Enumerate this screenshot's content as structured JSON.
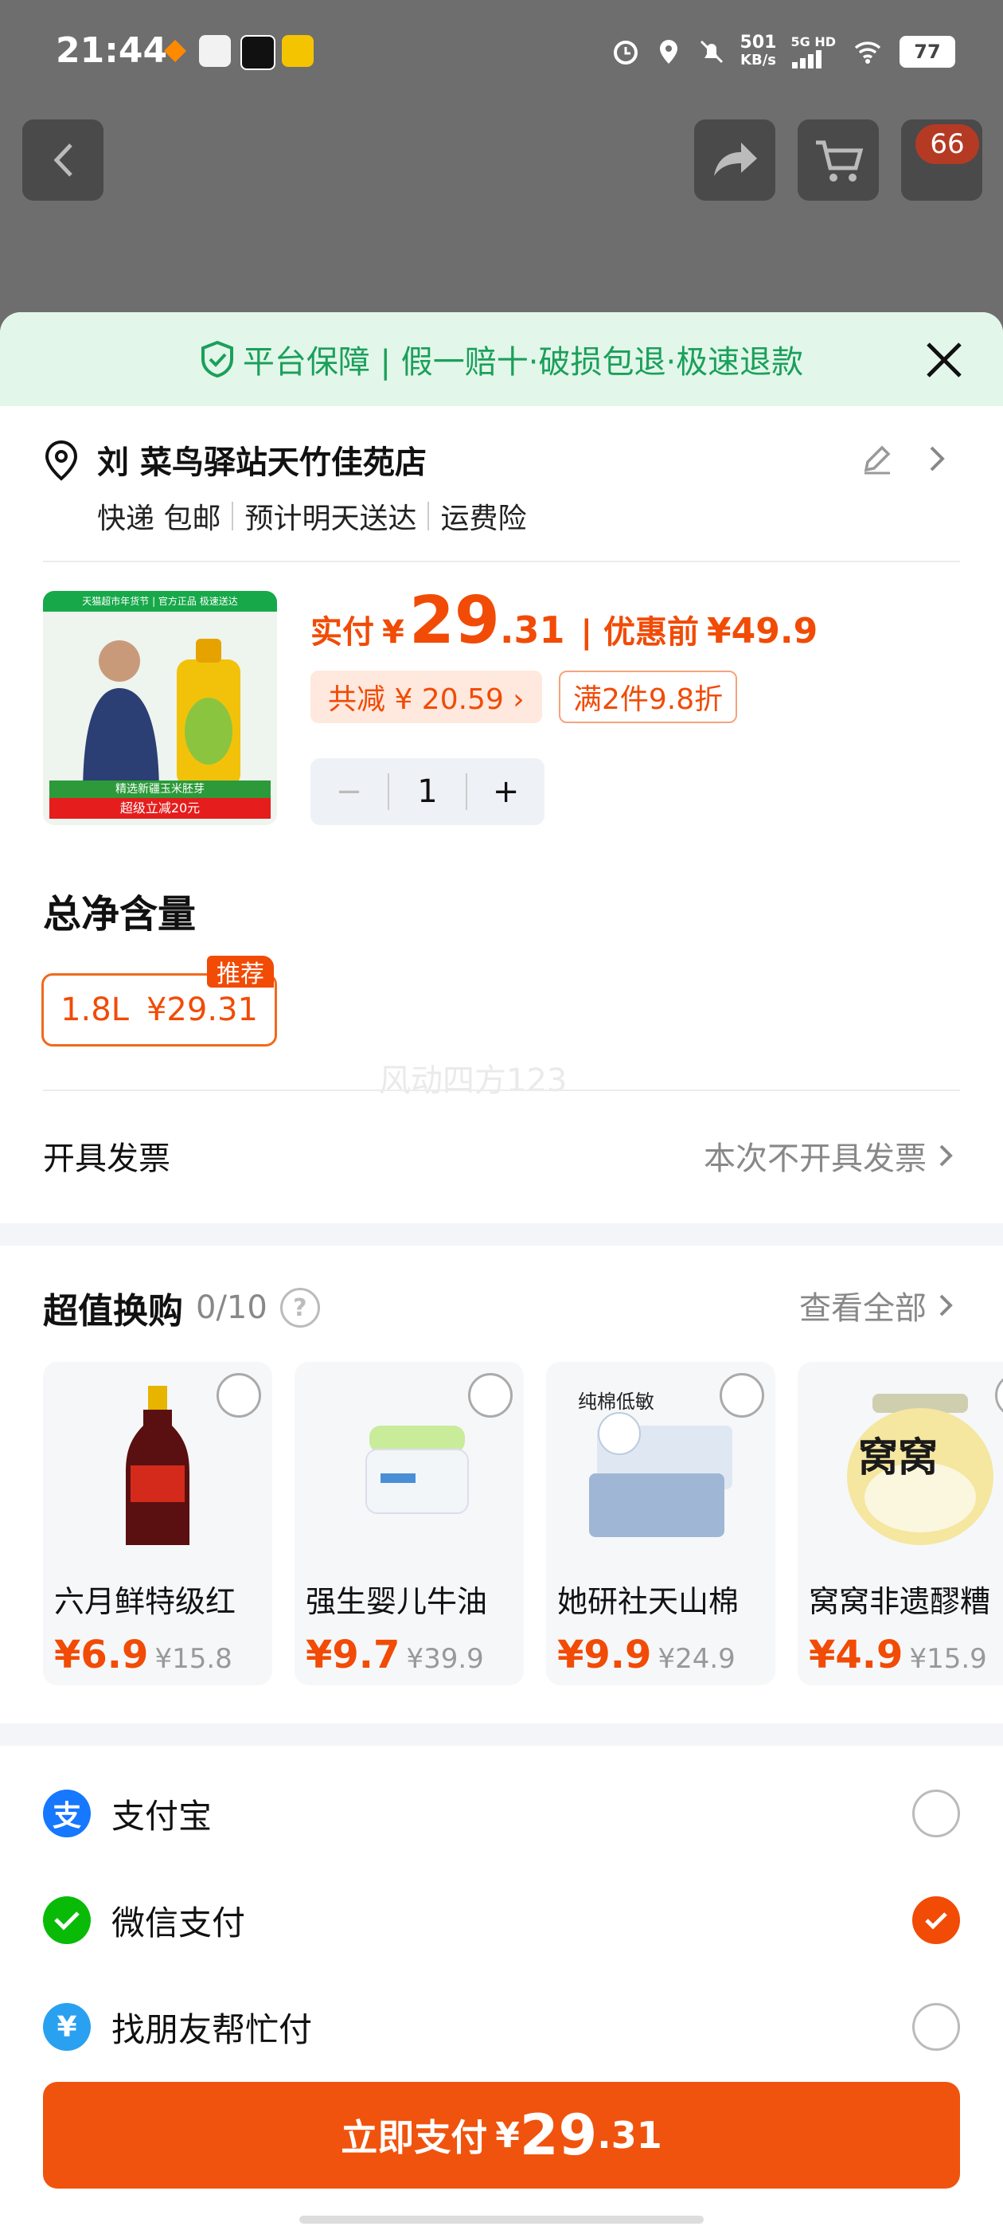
{
  "status_bar": {
    "time": "21:44",
    "net_speed": "501",
    "net_unit": "KB/s",
    "network": "5G HD",
    "battery": "77"
  },
  "cart_badge": "66",
  "guarantee": {
    "text": "平台保障 | 假一赔十·破损包退·极速退款"
  },
  "address": {
    "name": "刘 菜鸟驿站天竹佳苑店",
    "shipping": "快递 包邮",
    "eta": "预计明天送达",
    "insurance": "运费险"
  },
  "product": {
    "image_banner": "天猫超市年货节 | 官方正品 极速送达",
    "image_caption1": "精选新疆玉米胚芽",
    "image_caption2": "超级立减20元",
    "pay_label": "实付",
    "currency": "¥",
    "price_int": "29",
    "price_dec": ".31",
    "before_label": "| 优惠前",
    "before_price": "¥49.9",
    "discount": "共减 ¥ 20.59 ›",
    "promo": "满2件9.8折",
    "qty": "1",
    "qty_minus": "−",
    "qty_plus": "+"
  },
  "spec": {
    "title": "总净含量",
    "option_size": "1.8L",
    "option_price": "¥29.31",
    "badge": "推荐"
  },
  "watermark": "风动四方123",
  "invoice": {
    "label": "开具发票",
    "value": "本次不开具发票"
  },
  "swap": {
    "title": "超值换购",
    "count": "0/10",
    "help": "?",
    "view_all": "查看全部",
    "items": [
      {
        "name": "六月鲜特级红",
        "price": "¥6.9",
        "orig": "¥15.8"
      },
      {
        "name": "强生婴儿牛油",
        "price": "¥9.7",
        "orig": "¥39.9"
      },
      {
        "name": "她研社天山棉",
        "price": "¥9.9",
        "orig": "¥24.9"
      },
      {
        "name": "窝窝非遗醪糟",
        "price": "¥4.9",
        "orig": "¥15.9"
      }
    ],
    "item3_tag": "纯棉低敏",
    "item4_brand": "窝窝"
  },
  "payment": [
    {
      "label": "支付宝",
      "icon": "支",
      "color": "#1677ff",
      "selected": false
    },
    {
      "label": "微信支付",
      "icon": "✓",
      "color": "#09bb07",
      "selected": true
    },
    {
      "label": "找朋友帮忙付",
      "icon": "¥",
      "color": "#2aa0f0",
      "selected": false
    }
  ],
  "pay_button": {
    "label": "立即支付",
    "currency": "¥",
    "int": "29",
    "dec": ".31"
  },
  "colors": {
    "accent": "#f14b06",
    "green": "#1aa05a"
  }
}
